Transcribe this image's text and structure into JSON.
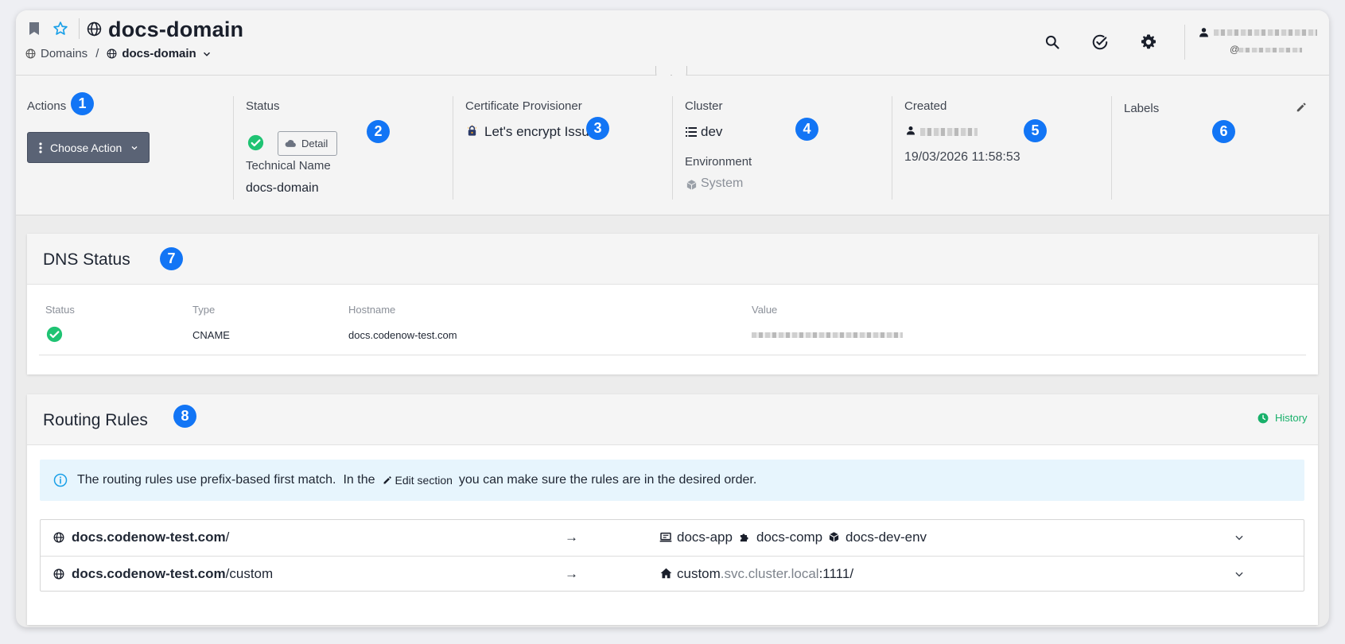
{
  "header": {
    "title": "docs-domain",
    "breadcrumb": {
      "root": "Domains",
      "separator": "/",
      "current": "docs-domain"
    },
    "user": {
      "name": "",
      "handle": "@"
    }
  },
  "info": {
    "actions": {
      "label": "Actions",
      "button": "Choose Action",
      "badge": "1"
    },
    "status": {
      "label": "Status",
      "detail_button": "Detail",
      "technical_name_label": "Technical Name",
      "technical_name": "docs-domain",
      "badge": "2"
    },
    "certificate": {
      "label": "Certificate Provisioner",
      "value": "Let's encrypt Issuer",
      "badge": "3"
    },
    "cluster": {
      "label": "Cluster",
      "value": "dev",
      "environment_label": "Environment",
      "environment": "System",
      "badge": "4"
    },
    "created": {
      "label": "Created",
      "date": "19/03/2026 11:58:53",
      "badge": "5"
    },
    "labels": {
      "label": "Labels",
      "badge": "6"
    }
  },
  "dns": {
    "title": "DNS Status",
    "badge": "7",
    "columns": [
      "Status",
      "Type",
      "Hostname",
      "Value"
    ],
    "rows": [
      {
        "type": "CNAME",
        "hostname": "docs.codenow-test.com"
      }
    ]
  },
  "routing": {
    "title": "Routing Rules",
    "badge": "8",
    "history": "History",
    "alert": {
      "part1": "The routing rules use prefix-based first match.",
      "part2": "In the",
      "edit": "Edit section",
      "part3": "you can make sure the rules are in the desired order."
    },
    "rules": [
      {
        "host": "docs.codenow-test.com",
        "path": "/",
        "arrow": "→",
        "app": "docs-app",
        "component": "docs-comp",
        "env": "docs-dev-env"
      },
      {
        "host": "docs.codenow-test.com",
        "path": "/custom",
        "arrow": "→",
        "svc_name": "custom",
        "svc_domain": ".svc.cluster.local",
        "svc_port": ":1111/"
      }
    ]
  },
  "colors": {
    "accent_blue": "#1275f5",
    "success_green": "#1fc373",
    "history_green": "#18b06a",
    "action_button": "#5a6375"
  }
}
